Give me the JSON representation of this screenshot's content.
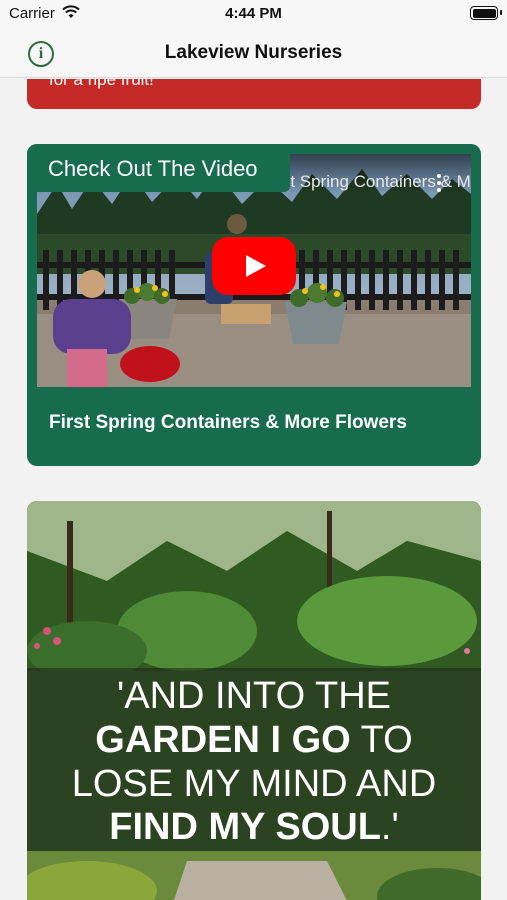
{
  "status_bar": {
    "carrier": "Carrier",
    "time": "4:44 PM"
  },
  "nav": {
    "title": "Lakeview Nurseries",
    "info_icon_label": "i"
  },
  "red_card": {
    "text": "for a ripe fruit!"
  },
  "video_card": {
    "badge": "Check Out The Video",
    "video_title": "First Spring Containers & Mor...",
    "caption": "First Spring Containers & More Flowers"
  },
  "garden_card": {
    "quote_line1": "'AND INTO THE",
    "quote_line2_bold": "GARDEN I GO",
    "quote_line2_rest": " TO",
    "quote_line3": "LOSE MY MIND AND",
    "quote_line4_bold": "FIND MY SOUL",
    "quote_line4_rest": ".'"
  },
  "colors": {
    "accent_green": "#166c4d",
    "alert_red": "#c62a27",
    "youtube_red": "#ff0000"
  }
}
